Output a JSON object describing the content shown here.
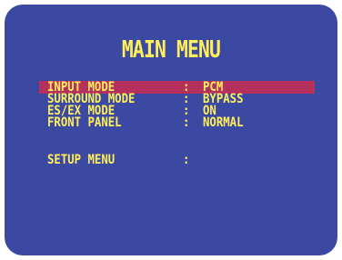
{
  "menu": {
    "title": "MAIN MENU",
    "items": [
      {
        "label": "INPUT MODE",
        "separator": ":",
        "value": "PCM",
        "selected": true
      },
      {
        "label": "SURROUND MODE",
        "separator": ":",
        "value": "BYPASS",
        "selected": false
      },
      {
        "label": "ES/EX MODE",
        "separator": ":",
        "value": "ON",
        "selected": false
      },
      {
        "label": "FRONT PANEL",
        "separator": ":",
        "value": "NORMAL",
        "selected": false
      },
      {
        "label": "SETUP MENU",
        "separator": ":",
        "value": "",
        "selected": false
      }
    ]
  },
  "colors": {
    "screen_background": "#3c49a3",
    "text": "#fff05a",
    "selection_highlight": "#b6305e"
  }
}
